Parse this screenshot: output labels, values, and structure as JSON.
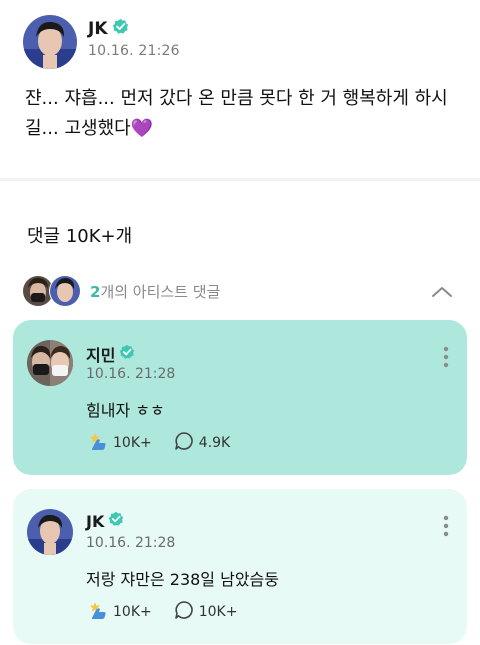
{
  "post": {
    "author": "JK",
    "time": "10.16. 21:26",
    "text": "쟌... 쟈흡... 먼저 갔다 온 만큼 못다 한 거 행복하게 하시길... 고생했다",
    "emoji": "💜"
  },
  "comments_header": {
    "count_label": "댓글 10K+개"
  },
  "artist_comments": {
    "count": "2",
    "label": "개의 아티스트 댓글"
  },
  "comments": [
    {
      "author": "지민",
      "time": "10.16. 21:28",
      "text": "힘내자 ㅎㅎ",
      "likes": "10K+",
      "replies": "4.9K"
    },
    {
      "author": "JK",
      "time": "10.16. 21:28",
      "text": "저랑 쟈만은 238일 남았슴둥",
      "likes": "10K+",
      "replies": "10K+"
    }
  ],
  "colors": {
    "accent": "#3bb9a8",
    "card_highlight": "#aee8dd",
    "card_light": "#e8faf6",
    "verified": "#3dc8b4",
    "heart": "#9b4ddb"
  },
  "icons": {
    "verified": "verified-badge-icon",
    "like": "like-icon",
    "reply": "reply-bubble-icon",
    "more": "more-vertical-icon",
    "collapse": "chevron-up-icon"
  }
}
